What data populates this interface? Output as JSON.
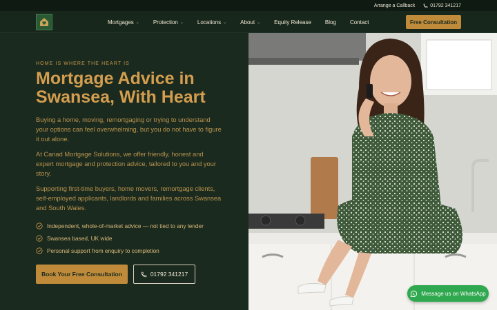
{
  "topbar": {
    "callback_label": "Arrange a Callback",
    "phone_label": "01792 341217"
  },
  "nav": {
    "logo_icon": "house-heart-logo",
    "items": [
      {
        "label": "Mortgages",
        "has_dropdown": true
      },
      {
        "label": "Protection",
        "has_dropdown": true
      },
      {
        "label": "Locations",
        "has_dropdown": true
      },
      {
        "label": "About",
        "has_dropdown": true
      },
      {
        "label": "Equity Release",
        "has_dropdown": false
      },
      {
        "label": "Blog",
        "has_dropdown": false
      },
      {
        "label": "Contact",
        "has_dropdown": false
      }
    ],
    "cta_label": "Free Consultation"
  },
  "hero": {
    "eyebrow": "HOME IS WHERE THE HEART IS",
    "headline": "Mortgage Advice in Swansea, With Heart",
    "paragraphs": [
      "Buying a home, moving, remortgaging or trying to understand your options can feel overwhelming, but you do not have to figure it out alone.",
      "At Cariad Mortgage Solutions, we offer friendly, honest and expert mortgage and protection advice, tailored to you and your story.",
      "Supporting first-time buyers, home movers, remortgage clients, self-employed applicants, landlords and families across Swansea and South Wales."
    ],
    "checks": [
      "Independent, whole-of-market advice — not tied to any lender",
      "Swansea based, UK wide",
      "Personal support from enquiry to completion"
    ],
    "primary_button": "Book Your Free Consultation",
    "phone_button": "01792 341217",
    "photo_icon": "advisor-photo"
  },
  "whatsapp": {
    "label": "Message us on WhatsApp",
    "icon": "whatsapp-icon"
  },
  "colors": {
    "background": "#1b2a1e",
    "accent_gold": "#bf8b3a",
    "headline_gold": "#d39e4f",
    "whatsapp_green": "#2fa84f"
  }
}
